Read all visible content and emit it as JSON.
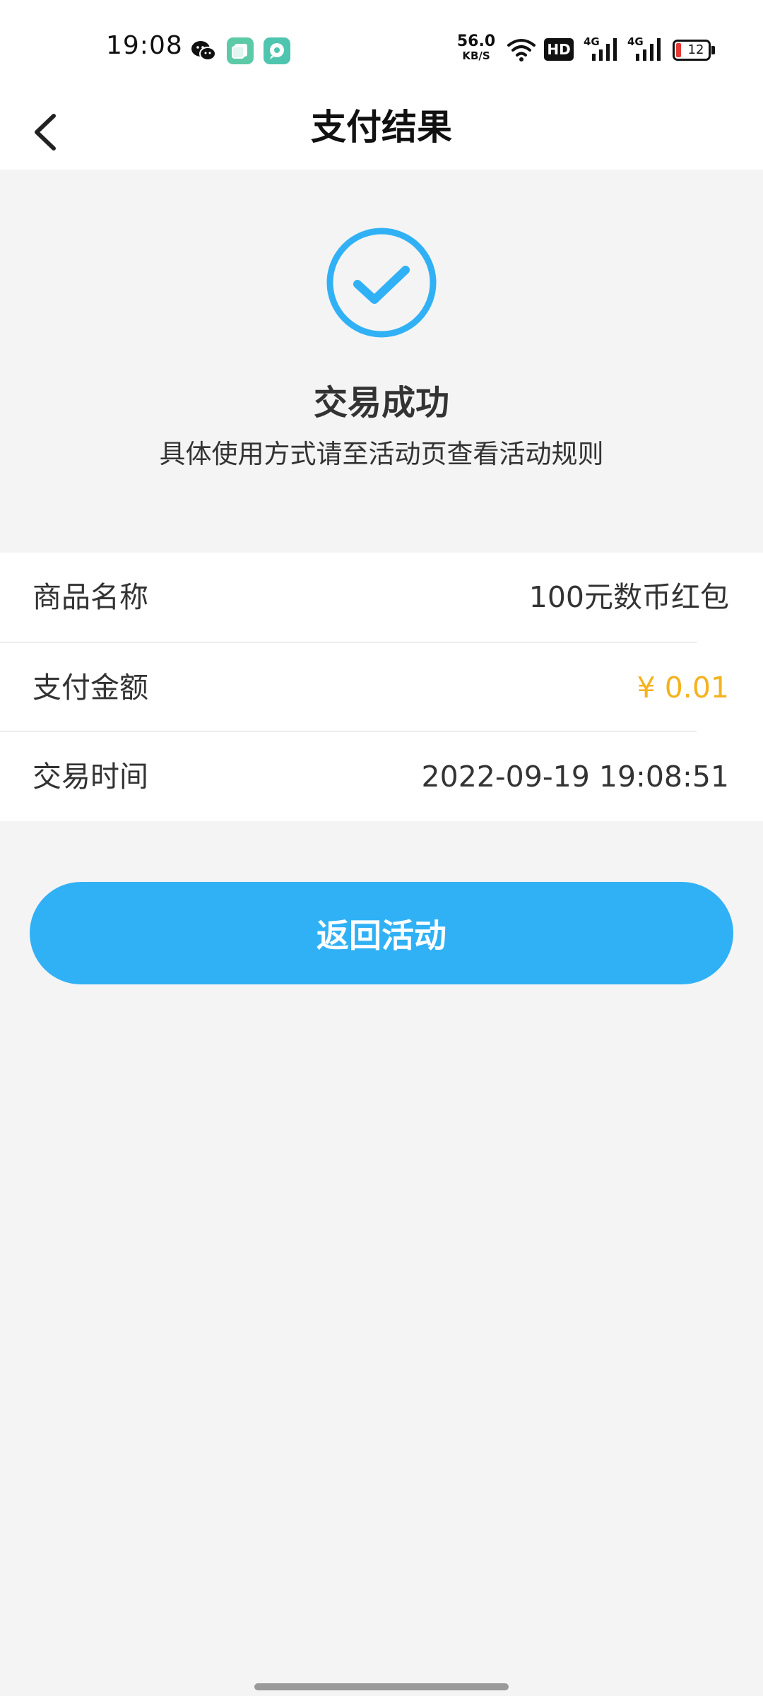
{
  "status_bar": {
    "time": "19:08",
    "net_speed_value": "56.0",
    "net_speed_unit": "KB/S",
    "hd_label": "HD",
    "signal1_label": "4G",
    "signal2_label": "4G",
    "battery_level": "12",
    "icons": [
      "wechat-icon",
      "app-green-icon",
      "app-chat-icon",
      "wifi-icon",
      "hd-icon",
      "signal-4g-icon",
      "signal-4g-icon",
      "battery-icon"
    ]
  },
  "header": {
    "title": "支付结果"
  },
  "result": {
    "title": "交易成功",
    "subtitle": "具体使用方式请至活动页查看活动规则"
  },
  "details": [
    {
      "label": "商品名称",
      "value": "100元数币红包"
    },
    {
      "label": "支付金额",
      "value": "¥ 0.01"
    },
    {
      "label": "交易时间",
      "value": "2022-09-19 19:08:51"
    }
  ],
  "action": {
    "return_label": "返回活动"
  },
  "colors": {
    "accent": "#31b1f5",
    "amount": "#f5b21f",
    "background": "#f4f4f4"
  }
}
